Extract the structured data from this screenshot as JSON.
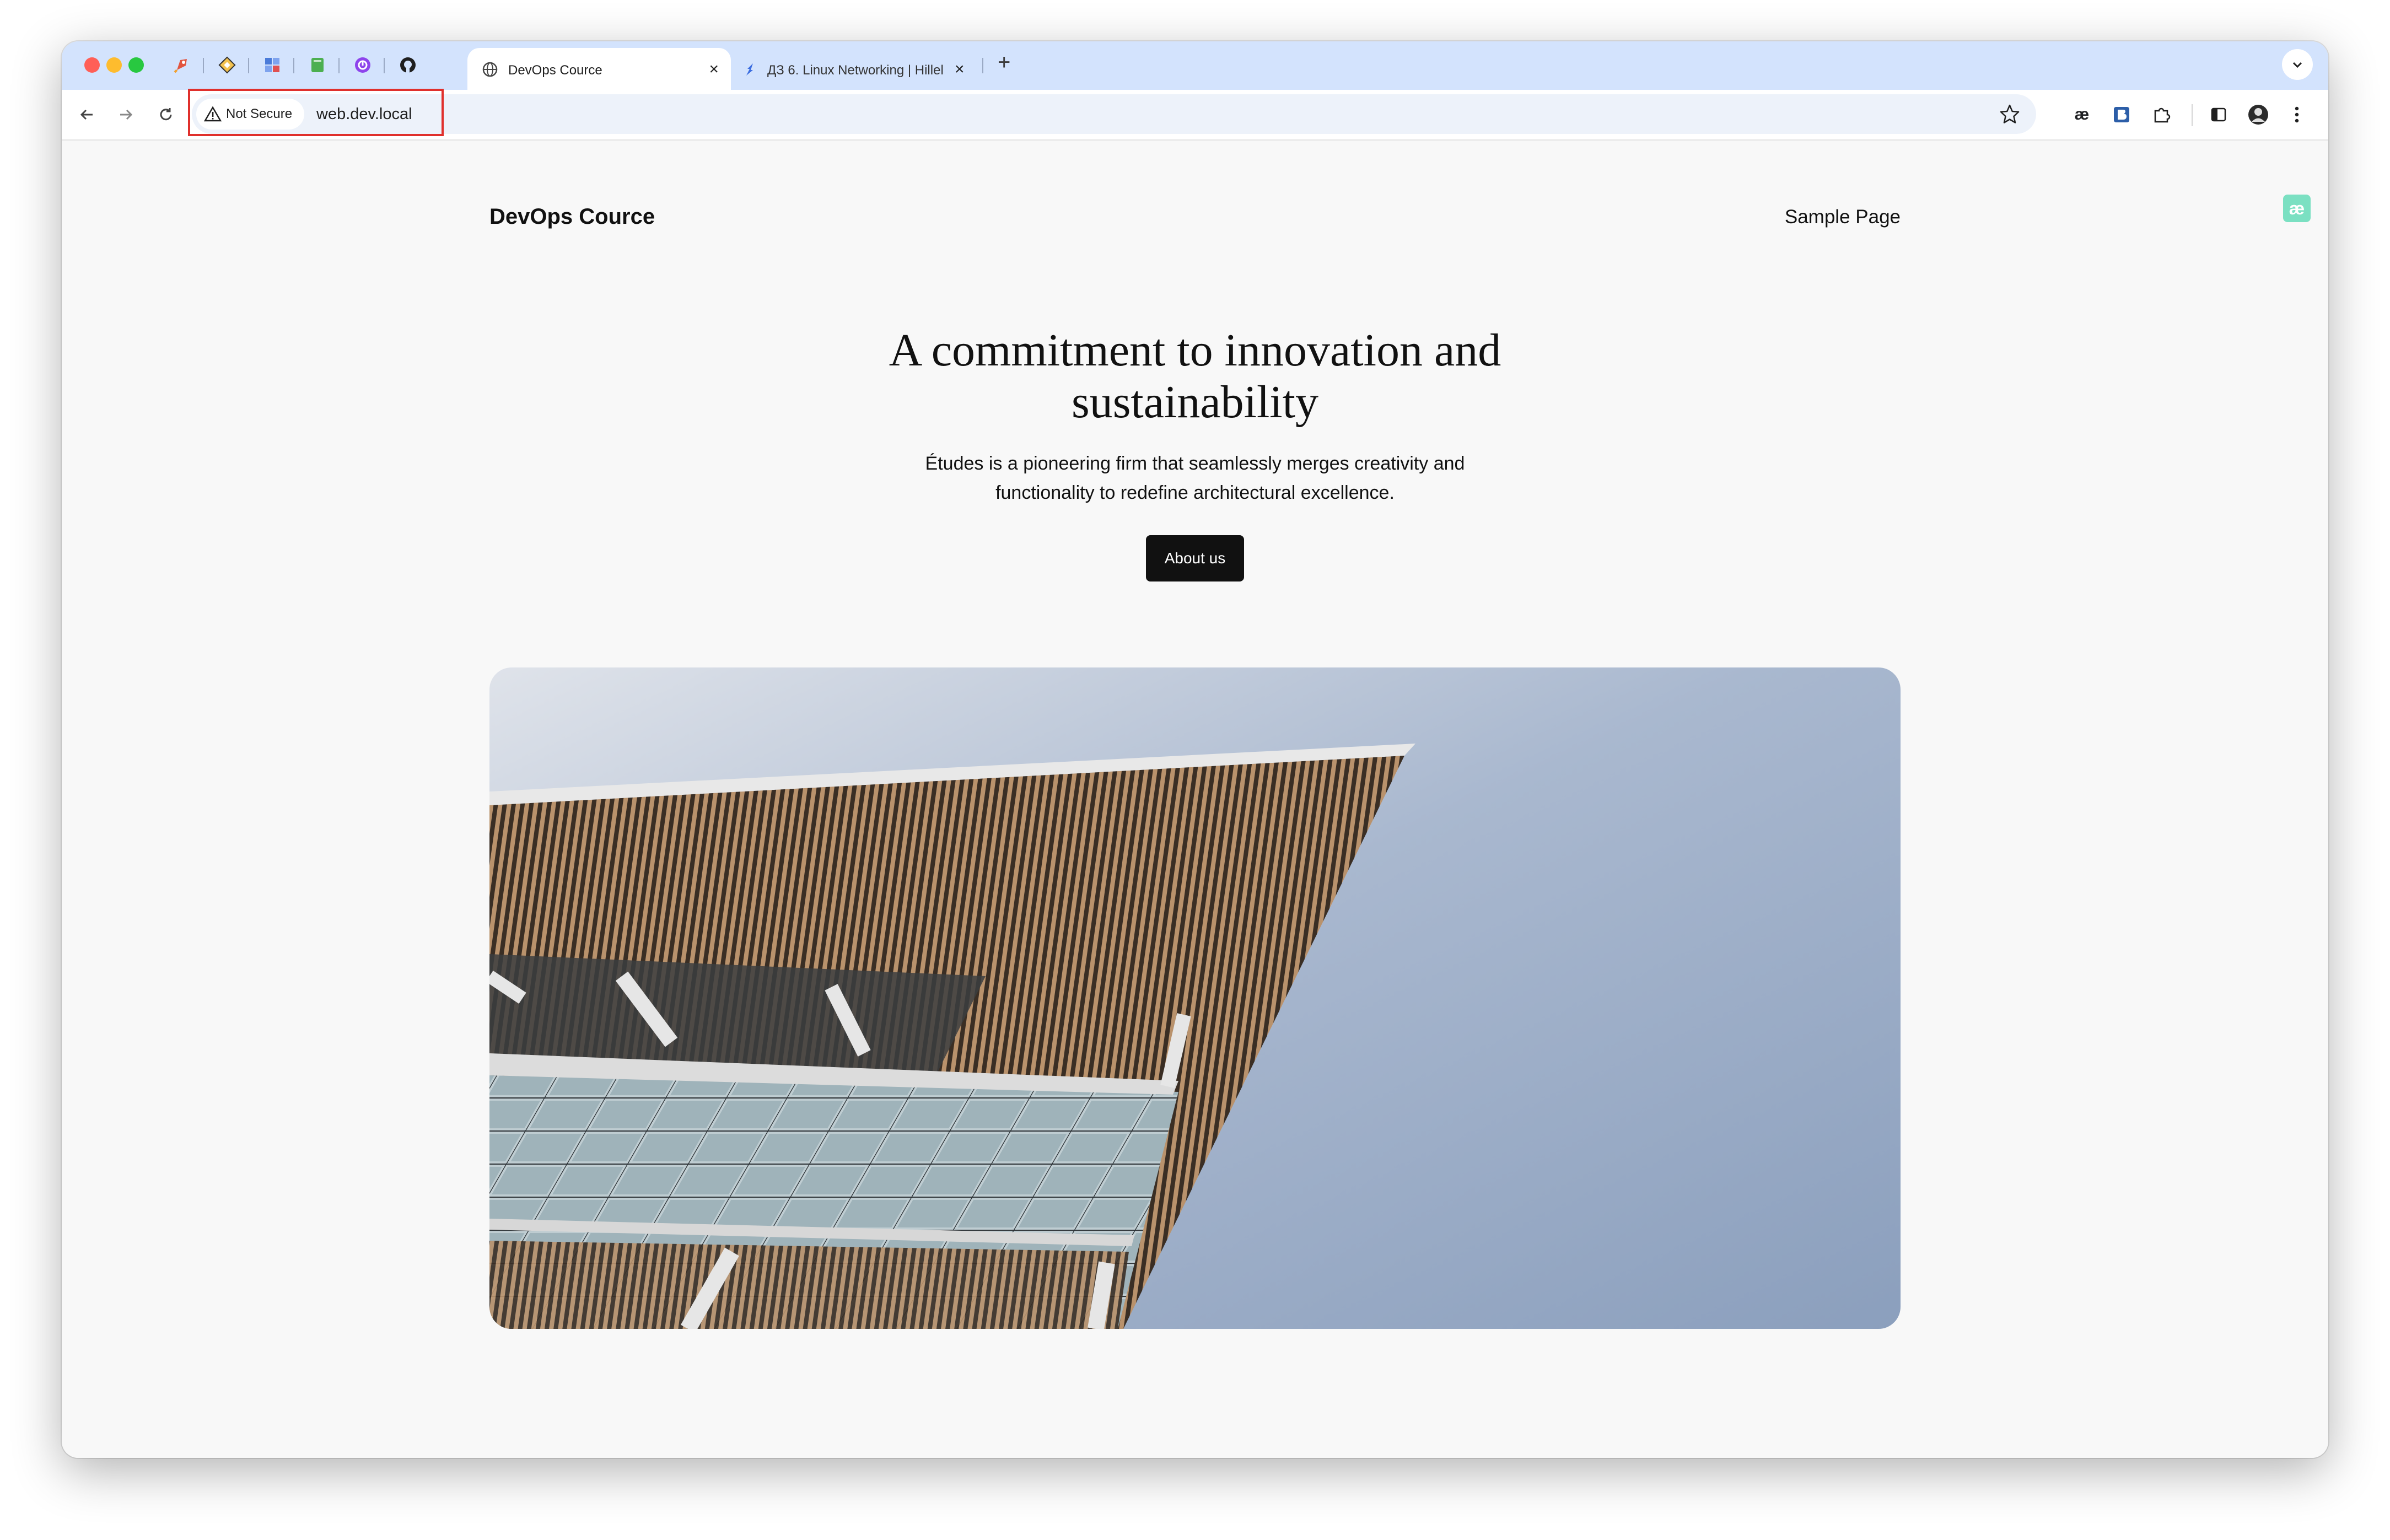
{
  "browser": {
    "tabs": [
      {
        "title": "DevOps Cource",
        "active": true
      },
      {
        "title": "ДЗ 6. Linux Networking | Hillel",
        "active": false
      }
    ],
    "pinned_tabs": [
      "rocket-extension-icon",
      "diamond-icon",
      "puzzle-app-icon",
      "green-book-icon",
      "purple-clock-icon",
      "github-icon"
    ],
    "omnibox": {
      "security_label": "Not Secure",
      "url": "web.dev.local"
    },
    "extensions": [
      "ae-extension-icon",
      "bitwarden-icon",
      "extensions-puzzle-icon",
      "side-panel-icon",
      "profile-avatar-icon",
      "more-menu-icon"
    ]
  },
  "site": {
    "title": "DevOps Cource",
    "nav": {
      "sample_page": "Sample Page"
    },
    "hero": {
      "heading": "A commitment to innovation and sustainability",
      "text": "Études is a pioneering firm that seamlessly merges creativity and functionality to redefine architectural excellence.",
      "button": "About us"
    }
  },
  "colors": {
    "tabstrip": "#d3e3fd",
    "highlight_box": "#e0302c",
    "button_bg": "#111111",
    "page_bg": "#f8f8f8"
  }
}
